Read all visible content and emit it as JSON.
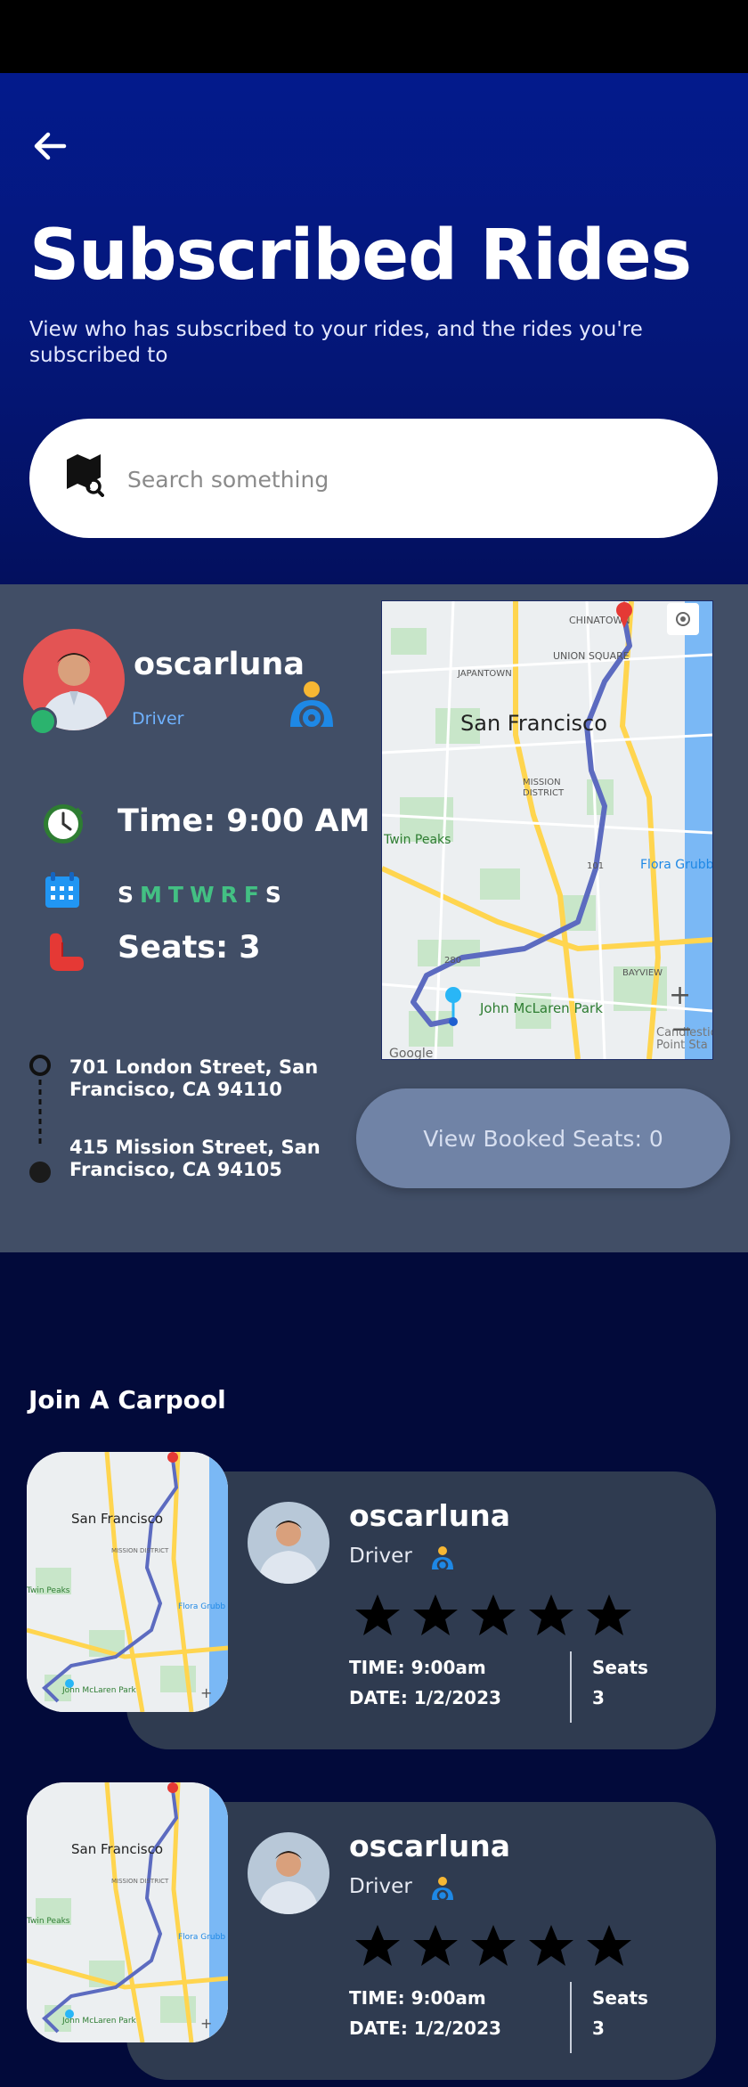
{
  "header": {
    "title": "Subscribed Rides",
    "subtitle": "View who has subscribed to your rides, and the rides you're subscribed to"
  },
  "search": {
    "placeholder": "Search something",
    "value": ""
  },
  "ride": {
    "driver_name": "oscarluna",
    "driver_role": "Driver",
    "time_label": "Time: 9:00 AM",
    "days": [
      {
        "letter": "S",
        "active": false
      },
      {
        "letter": "M",
        "active": true
      },
      {
        "letter": "T",
        "active": true
      },
      {
        "letter": "W",
        "active": true
      },
      {
        "letter": "R",
        "active": true
      },
      {
        "letter": "F",
        "active": true
      },
      {
        "letter": "S",
        "active": false
      }
    ],
    "seats_label": "Seats: 3",
    "pickup_address": "701 London Street, San Francisco, CA 94110",
    "dropoff_address": "415 Mission Street, San Francisco, CA 94105",
    "view_button_label": "View Booked Seats: 0",
    "map": {
      "city_label": "San Francisco",
      "labels": [
        "CHINATOWN",
        "UNION SQUARE",
        "JAPANTOWN",
        "MISSION DISTRICT",
        "Twin Peaks",
        "Flora Grubb",
        "BAYVIEW",
        "John McLaren Park",
        "101",
        "280",
        "Candlestick Point Sta",
        "Google"
      ]
    }
  },
  "carpool": {
    "section_title": "Join A Carpool",
    "cards": [
      {
        "name": "oscarluna",
        "role": "Driver",
        "rating": 5,
        "time": "TIME: 9:00am",
        "date": "DATE: 1/2/2023",
        "seats_label": "Seats",
        "seats_value": "3",
        "map_labels": [
          "San Francisco",
          "MISSION DISTRICT",
          "Twin Peaks",
          "Flora Grubb",
          "John McLaren Park"
        ]
      },
      {
        "name": "oscarluna",
        "role": "Driver",
        "rating": 5,
        "time": "TIME: 9:00am",
        "date": "DATE: 1/2/2023",
        "seats_label": "Seats",
        "seats_value": "3",
        "map_labels": [
          "San Francisco",
          "MISSION DISTRICT",
          "Twin Peaks",
          "Flora Grubb",
          "John McLaren Park"
        ]
      }
    ]
  },
  "colors": {
    "header": "#031a8c",
    "panel": "#414e66",
    "card": "#2f3b50",
    "accent_green": "#43c083",
    "button": "#7083a6"
  },
  "icons": [
    "back-arrow-icon",
    "map-search-icon",
    "driver-icon",
    "clock-icon",
    "calendar-icon",
    "seat-icon",
    "map-pin-icon",
    "star-icon",
    "locate-icon",
    "zoom-in-icon",
    "zoom-out-icon"
  ]
}
